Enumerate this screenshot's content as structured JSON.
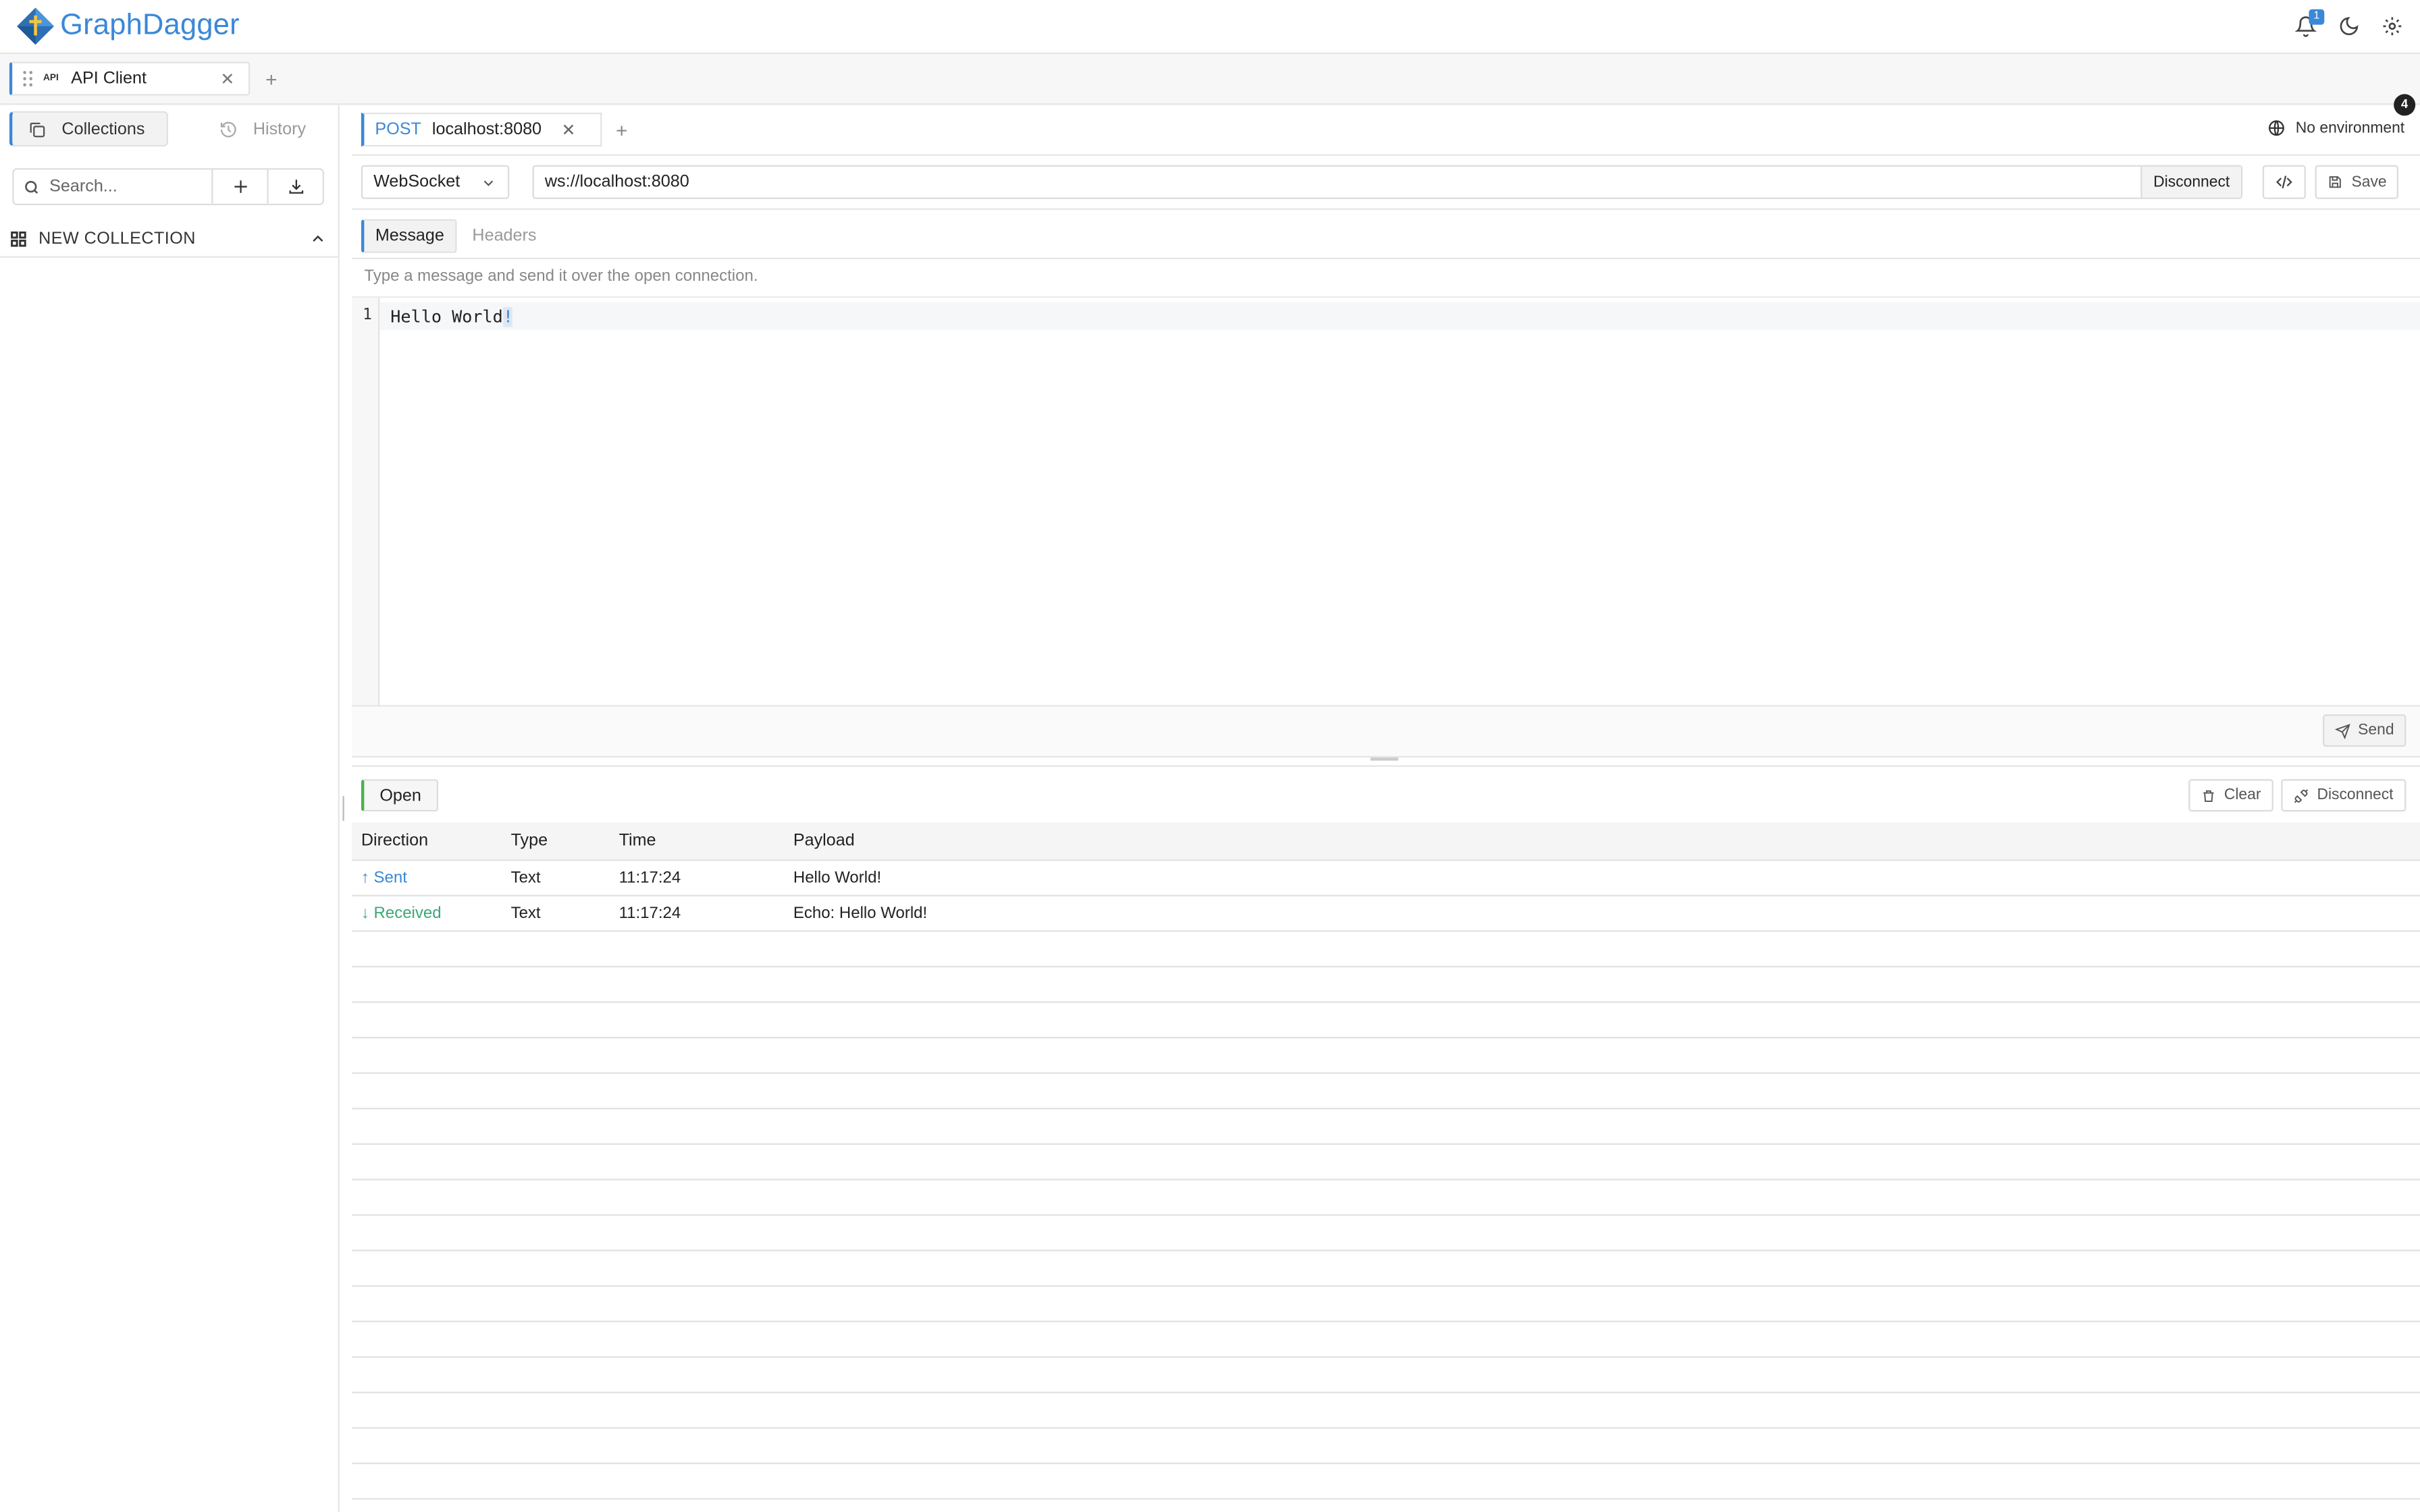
{
  "app": {
    "name": "GraphDagger",
    "notification_count": "1"
  },
  "workspace_tabs": [
    {
      "icon": "API",
      "label": "API Client"
    }
  ],
  "sidebar": {
    "tabs": [
      {
        "label": "Collections"
      },
      {
        "label": "History"
      }
    ],
    "search_placeholder": "Search...",
    "collection": {
      "name": "NEW COLLECTION"
    }
  },
  "request_tab": {
    "method": "POST",
    "url": "localhost:8080"
  },
  "environment": {
    "label": "No environment",
    "badge": "4"
  },
  "request": {
    "protocol": "WebSocket",
    "url": "ws://localhost:8080",
    "connect_button": "Disconnect",
    "save_label": "Save"
  },
  "message_tabs": [
    {
      "label": "Message"
    },
    {
      "label": "Headers"
    }
  ],
  "editor": {
    "hint": "Type a message and send it over the open connection.",
    "line_number": "1",
    "text": "Hello World",
    "cursor_char": "!",
    "send_label": "Send"
  },
  "response": {
    "status": "Open",
    "clear_label": "Clear",
    "disconnect_label": "Disconnect",
    "columns": [
      "Direction",
      "Type",
      "Time",
      "Payload"
    ],
    "rows": [
      {
        "direction": "↑ Sent",
        "type": "Text",
        "time": "11:17:24",
        "payload": "Hello World!"
      },
      {
        "direction": "↓ Received",
        "type": "Text",
        "time": "11:17:24",
        "payload": "Echo: Hello World!"
      }
    ]
  },
  "colors": {
    "accent": "#3b88d6",
    "received": "#3aa877",
    "status_open": "#4caf50"
  }
}
